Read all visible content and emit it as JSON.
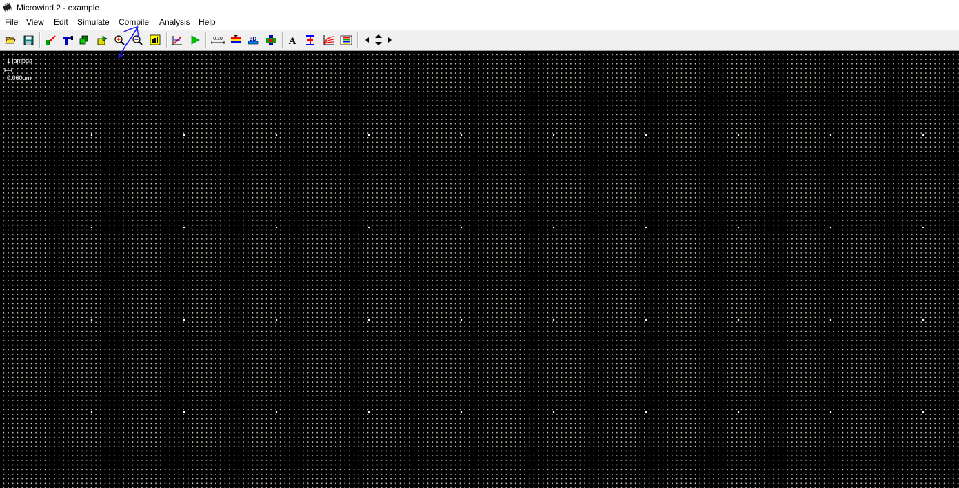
{
  "window": {
    "title": "Microwind 2 - example"
  },
  "menu": {
    "items": [
      {
        "id": "file",
        "label": "File"
      },
      {
        "id": "view",
        "label": "View"
      },
      {
        "id": "edit",
        "label": "Edit"
      },
      {
        "id": "simulate",
        "label": "Simulate"
      },
      {
        "id": "compile",
        "label": "Compile"
      },
      {
        "id": "analysis",
        "label": "Analysis"
      },
      {
        "id": "help",
        "label": "Help"
      }
    ]
  },
  "toolbar": {
    "buttons": [
      {
        "id": "open",
        "icon": "open-folder-icon"
      },
      {
        "id": "save",
        "icon": "save-disk-icon"
      },
      {
        "id": "draw-box",
        "icon": "draw-box-icon"
      },
      {
        "id": "delete",
        "icon": "delete-paint-gun-icon"
      },
      {
        "id": "copy",
        "icon": "copy-icon"
      },
      {
        "id": "stretch",
        "icon": "stretch-move-icon"
      },
      {
        "id": "zoom-in",
        "icon": "zoom-in-icon"
      },
      {
        "id": "zoom-out",
        "icon": "zoom-out-icon"
      },
      {
        "id": "view-all",
        "icon": "view-all-icon"
      },
      {
        "id": "connect",
        "icon": "connection-icon"
      },
      {
        "id": "simulate",
        "icon": "run-simulation-icon"
      },
      {
        "id": "measure",
        "icon": "measure-distance-icon"
      },
      {
        "id": "cross-section",
        "icon": "cross-section-icon"
      },
      {
        "id": "view-3d",
        "icon": "3d-view-icon"
      },
      {
        "id": "mos-view",
        "icon": "mos-characteristics-icon"
      },
      {
        "id": "text",
        "icon": "add-text-icon"
      },
      {
        "id": "vertical-cut",
        "icon": "vertical-cut-icon"
      },
      {
        "id": "mos-curves",
        "icon": "mos-curves-icon"
      },
      {
        "id": "palette",
        "icon": "layer-palette-icon"
      },
      {
        "id": "navigate",
        "icon": "navigation-arrows-icon"
      }
    ],
    "measure_label": "0.10",
    "view_3d_label": "3D"
  },
  "canvas": {
    "scale_label": "1 lambda",
    "scale_value": "0.060µm",
    "background": "#000000",
    "grid_color": "#d8d8c8"
  }
}
